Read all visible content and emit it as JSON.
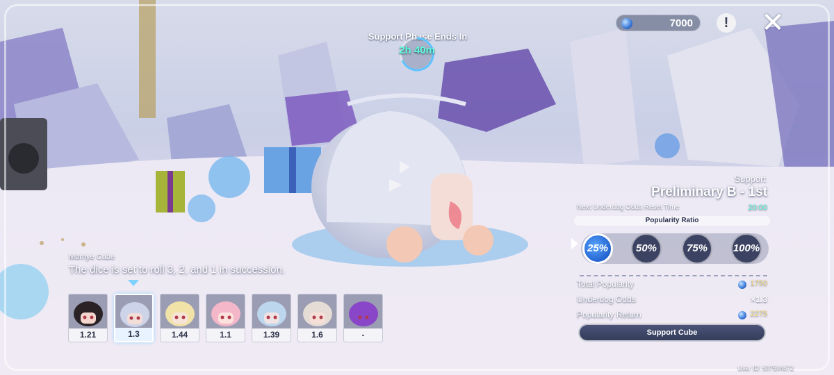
{
  "header": {
    "currency_value": "7000",
    "phase_title": "Support Phase Ends In",
    "phase_time": "2h 40m"
  },
  "panel": {
    "support_label": "Support",
    "stage_title": "Preliminary B - 1st",
    "reset_label": "Next Underdog Odds Reset Time",
    "reset_time": "20:00",
    "ratio_title": "Popularity Ratio",
    "ratio_options": [
      "25%",
      "50%",
      "75%",
      "100%"
    ],
    "selected_ratio": "25%",
    "stats": {
      "total_popularity_label": "Total Popularity",
      "total_popularity_value": "1750",
      "underdog_odds_label": "Underdog Odds",
      "underdog_odds_value": "×1.3",
      "popularity_return_label": "Popularity Return",
      "popularity_return_value": "2275"
    },
    "support_button": "Support Cube",
    "user_id": "User ID: 507594672"
  },
  "cube": {
    "name": "Mornye Cube",
    "description": "The dice is set to roll 3, 2, and 1 in succession.",
    "selected_index": 1,
    "cards": [
      {
        "odds": "1.21",
        "hair": "#2b2226",
        "face": "#f4d6cd"
      },
      {
        "odds": "1.3",
        "hair": "#cdd3e8",
        "face": "#f3ddd7"
      },
      {
        "odds": "1.44",
        "hair": "#f1e2a8",
        "face": "#f7e4d8"
      },
      {
        "odds": "1.1",
        "hair": "#f3b7c9",
        "face": "#fbe2dc"
      },
      {
        "odds": "1.39",
        "hair": "#bcd6ee",
        "face": "#f0e3e3"
      },
      {
        "odds": "1.6",
        "hair": "#e6dcd6",
        "face": "#f6dfd6"
      },
      {
        "odds": "-",
        "hair": "#8a46c8",
        "face": "#8a46c8"
      }
    ]
  },
  "colors": {
    "accent_teal": "#63ffe0",
    "selected_blue": "#2f74d8",
    "gold": "#f7e07a"
  }
}
